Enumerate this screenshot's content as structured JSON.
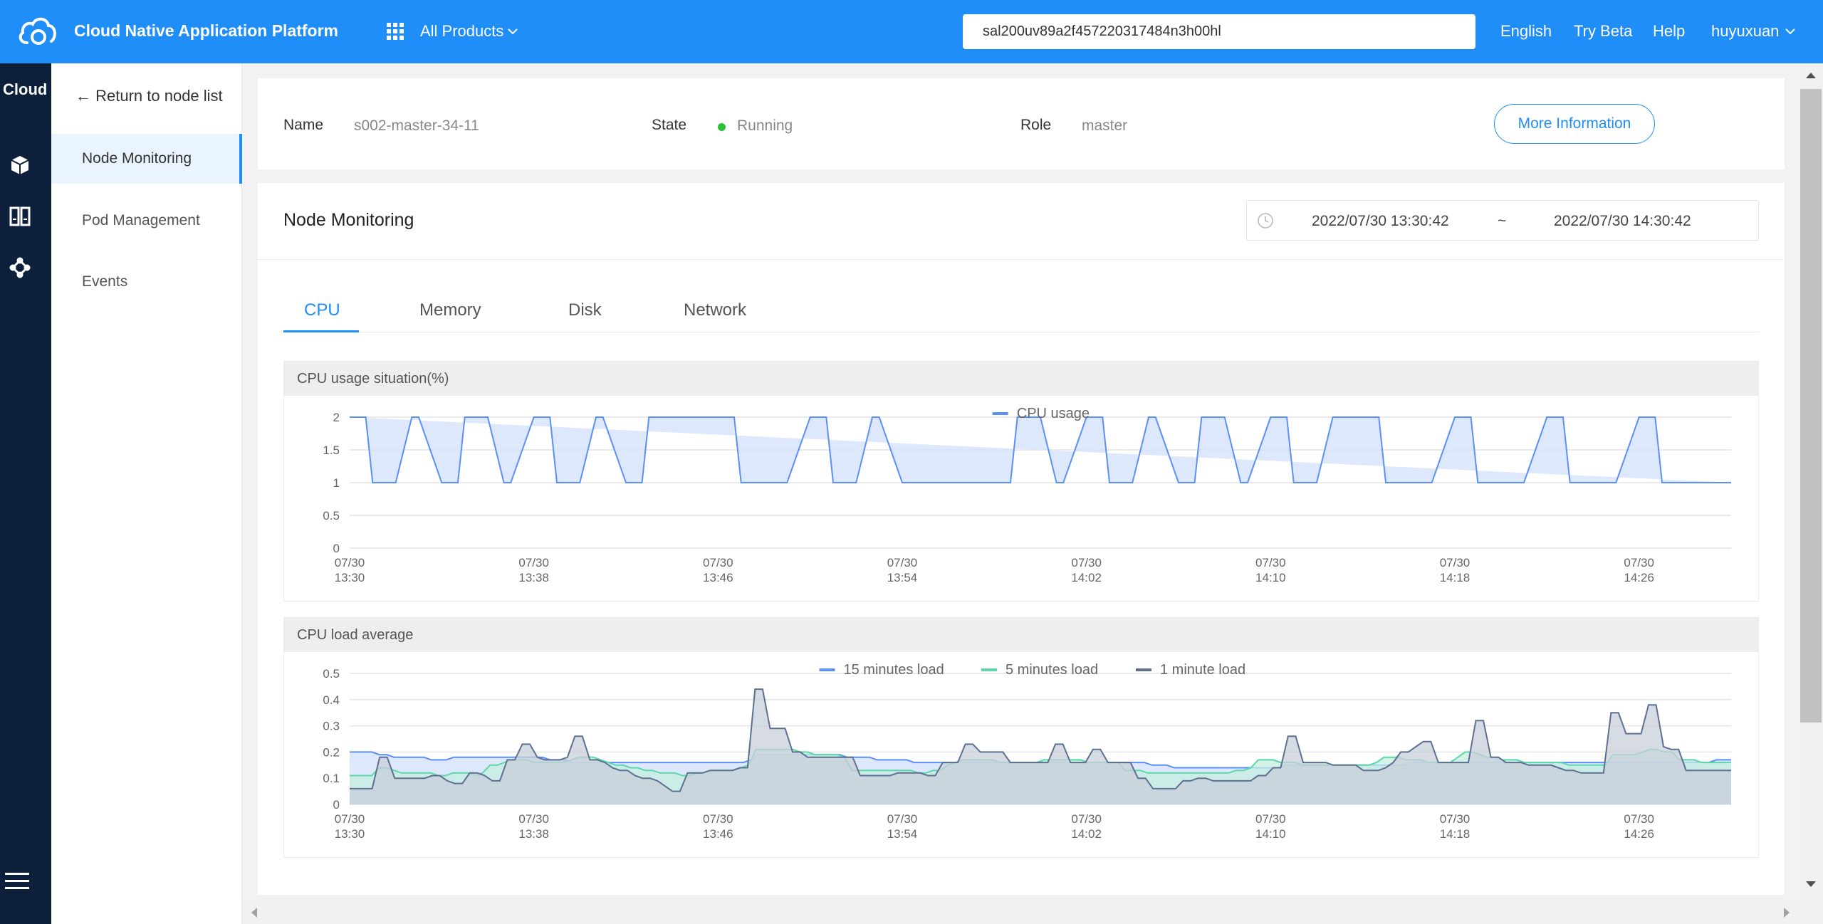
{
  "header": {
    "app_title": "Cloud Native Application Platform",
    "all_products": "All Products",
    "search_value": "sal200uv89a2f457220317484n3h00hl",
    "language": "English",
    "try_beta": "Try Beta",
    "help": "Help",
    "user": "huyuxuan",
    "bar_color": "#1f8ef8"
  },
  "rail": {
    "title": "Cloud",
    "icons": [
      "cube-icon",
      "columns-icon",
      "cluster-nodes-icon"
    ],
    "menu_icon": "hamburger-menu-icon"
  },
  "subnav": {
    "back_label": "← Return to node list",
    "items": [
      {
        "label": "Node Monitoring",
        "active": true
      },
      {
        "label": "Pod Management",
        "active": false
      },
      {
        "label": "Events",
        "active": false
      }
    ]
  },
  "node_info": {
    "name_label": "Name",
    "name_value": "s002-master-34-11",
    "state_label": "State",
    "state_value": "Running",
    "state_color": "#2bc234",
    "role_label": "Role",
    "role_value": "master",
    "more_button": "More Information"
  },
  "monitoring": {
    "title": "Node Monitoring",
    "time_start": "2022/07/30 13:30:42",
    "time_sep": "~",
    "time_end": "2022/07/30 14:30:42",
    "tabs": [
      {
        "label": "CPU",
        "active": true
      },
      {
        "label": "Memory",
        "active": false
      },
      {
        "label": "Disk",
        "active": false
      },
      {
        "label": "Network",
        "active": false
      }
    ],
    "cpu_usage_title": "CPU usage situation(%)",
    "cpu_load_title": "CPU load average"
  },
  "chart_data": [
    {
      "type": "area",
      "title": "CPU usage situation(%)",
      "x_ticks": [
        "07/30\n13:30",
        "07/30\n13:38",
        "07/30\n13:46",
        "07/30\n13:54",
        "07/30\n14:02",
        "07/30\n14:10",
        "07/30\n14:18",
        "07/30\n14:26"
      ],
      "ylim": [
        0,
        2
      ],
      "y_ticks": [
        0,
        0.5,
        1,
        1.5,
        2
      ],
      "grid": true,
      "legend_position": "top-center",
      "series": [
        {
          "name": "CPU usage",
          "color": "#5b8ff9",
          "fill": "#d3e0fb",
          "x_minutes": [
            0,
            0.7,
            1,
            2,
            2.7,
            3,
            4,
            4.7,
            5,
            6,
            6.7,
            7,
            8,
            8.7,
            9,
            10,
            10.7,
            11,
            12,
            12.7,
            13,
            14,
            14.7,
            15,
            16,
            16.7,
            17,
            18,
            18.7,
            19,
            20,
            20.7,
            21,
            22,
            22.7,
            23,
            24,
            24.7,
            25,
            26,
            26.7,
            27,
            28,
            28.7,
            29,
            30,
            30.7,
            31,
            32,
            32.7,
            33,
            34,
            34.7,
            35,
            36,
            36.7,
            37,
            38,
            38.7,
            39,
            40,
            40.7,
            41,
            42,
            42.7,
            43,
            44,
            44.7,
            45,
            46,
            46.7,
            47,
            48,
            48.7,
            49,
            50,
            50.7,
            51,
            52,
            52.7,
            53,
            54,
            54.7,
            55,
            56,
            56.7,
            57,
            58,
            58.7,
            59,
            60
          ],
          "values": [
            2,
            2,
            1,
            1,
            2,
            2,
            1,
            1,
            2,
            2,
            1,
            1,
            2,
            2,
            1,
            1,
            2,
            2,
            1,
            1,
            2,
            2,
            2,
            2,
            2,
            2,
            1,
            1,
            1,
            1,
            2,
            2,
            1,
            1,
            2,
            2,
            1,
            1,
            1,
            1,
            1,
            1,
            1,
            1,
            2,
            2,
            1,
            1,
            2,
            2,
            1,
            1,
            2,
            2,
            1,
            1,
            2,
            2,
            1,
            1,
            2,
            2,
            1,
            1,
            2,
            2,
            2,
            2,
            1,
            1,
            1,
            1,
            2,
            2,
            1,
            1,
            1,
            1,
            2,
            2,
            1,
            1,
            1,
            1,
            2,
            2,
            1,
            1,
            1,
            1,
            1,
            1
          ]
        }
      ]
    },
    {
      "type": "area",
      "title": "CPU load average",
      "x_ticks": [
        "07/30\n13:30",
        "07/30\n13:38",
        "07/30\n13:46",
        "07/30\n13:54",
        "07/30\n14:02",
        "07/30\n14:10",
        "07/30\n14:18",
        "07/30\n14:26"
      ],
      "ylim": [
        0,
        0.5
      ],
      "y_ticks": [
        0,
        0.1,
        0.2,
        0.3,
        0.4,
        0.5
      ],
      "grid": true,
      "legend_position": "top-center",
      "series": [
        {
          "name": "15 minutes load",
          "color": "#5b8ff9",
          "fill": "#d3e0fb",
          "values": [
            0.2,
            0.2,
            0.2,
            0.2,
            0.19,
            0.19,
            0.18,
            0.18,
            0.18,
            0.18,
            0.18,
            0.17,
            0.17,
            0.17,
            0.18,
            0.18,
            0.18,
            0.18,
            0.18,
            0.18,
            0.18,
            0.18,
            0.18,
            0.18,
            0.18,
            0.18,
            0.18,
            0.17,
            0.17,
            0.17,
            0.16,
            0.16,
            0.16,
            0.16,
            0.16,
            0.16,
            0.16,
            0.16,
            0.16,
            0.16,
            0.16,
            0.16,
            0.16,
            0.16,
            0.16,
            0.16,
            0.16,
            0.16,
            0.16,
            0.16,
            0.16,
            0.16,
            0.16,
            0.16,
            0.17,
            0.19,
            0.19,
            0.19,
            0.19,
            0.19,
            0.19,
            0.19,
            0.19,
            0.19,
            0.19,
            0.19,
            0.19,
            0.18,
            0.18,
            0.18,
            0.18,
            0.17,
            0.17,
            0.17,
            0.17,
            0.17,
            0.16,
            0.16,
            0.16,
            0.16,
            0.16,
            0.16,
            0.16,
            0.16,
            0.16,
            0.16,
            0.16,
            0.16,
            0.16,
            0.16,
            0.16,
            0.16,
            0.16,
            0.16,
            0.16,
            0.16,
            0.16,
            0.16,
            0.16,
            0.16,
            0.16,
            0.16,
            0.16,
            0.16,
            0.16,
            0.16,
            0.16,
            0.16,
            0.15,
            0.15,
            0.15,
            0.14,
            0.14,
            0.14,
            0.14,
            0.14,
            0.14,
            0.14,
            0.14,
            0.14,
            0.14,
            0.14,
            0.14,
            0.14,
            0.14,
            0.14,
            0.15,
            0.15,
            0.15,
            0.15,
            0.15,
            0.15,
            0.15,
            0.15,
            0.15,
            0.15,
            0.15,
            0.15,
            0.15,
            0.15,
            0.15,
            0.15,
            0.15,
            0.16,
            0.16,
            0.16,
            0.16,
            0.16,
            0.16,
            0.16,
            0.16,
            0.16,
            0.16,
            0.16,
            0.16,
            0.16,
            0.16,
            0.16,
            0.16,
            0.16,
            0.16,
            0.16,
            0.16,
            0.16,
            0.16,
            0.16,
            0.16,
            0.16,
            0.16,
            0.16,
            0.16,
            0.16,
            0.16,
            0.16,
            0.16,
            0.16,
            0.16,
            0.16,
            0.16,
            0.16,
            0.16,
            0.16,
            0.16,
            0.16,
            0.17,
            0.17,
            0.17
          ]
        },
        {
          "name": "5 minutes load",
          "color": "#5ad8a6",
          "fill": "#c6eee0",
          "values": [
            0.11,
            0.11,
            0.11,
            0.11,
            0.14,
            0.14,
            0.13,
            0.12,
            0.12,
            0.12,
            0.12,
            0.12,
            0.11,
            0.11,
            0.12,
            0.12,
            0.12,
            0.11,
            0.12,
            0.15,
            0.15,
            0.16,
            0.17,
            0.17,
            0.17,
            0.16,
            0.16,
            0.16,
            0.16,
            0.16,
            0.17,
            0.18,
            0.18,
            0.18,
            0.17,
            0.16,
            0.15,
            0.15,
            0.14,
            0.14,
            0.13,
            0.13,
            0.12,
            0.12,
            0.12,
            0.11,
            0.11,
            0.12,
            0.12,
            0.13,
            0.13,
            0.13,
            0.13,
            0.14,
            0.15,
            0.21,
            0.21,
            0.21,
            0.21,
            0.21,
            0.21,
            0.2,
            0.2,
            0.19,
            0.19,
            0.19,
            0.19,
            0.18,
            0.13,
            0.13,
            0.13,
            0.13,
            0.13,
            0.13,
            0.13,
            0.13,
            0.13,
            0.12,
            0.12,
            0.13,
            0.13,
            0.15,
            0.16,
            0.17,
            0.17,
            0.17,
            0.17,
            0.17,
            0.16,
            0.16,
            0.16,
            0.16,
            0.16,
            0.16,
            0.17,
            0.17,
            0.17,
            0.17,
            0.17,
            0.17,
            0.16,
            0.16,
            0.16,
            0.16,
            0.16,
            0.13,
            0.13,
            0.13,
            0.12,
            0.12,
            0.12,
            0.12,
            0.12,
            0.12,
            0.12,
            0.12,
            0.12,
            0.12,
            0.12,
            0.12,
            0.13,
            0.13,
            0.14,
            0.17,
            0.17,
            0.17,
            0.16,
            0.16,
            0.16,
            0.15,
            0.15,
            0.15,
            0.15,
            0.15,
            0.15,
            0.15,
            0.15,
            0.15,
            0.15,
            0.16,
            0.18,
            0.18,
            0.18,
            0.17,
            0.17,
            0.17,
            0.16,
            0.16,
            0.16,
            0.16,
            0.18,
            0.2,
            0.2,
            0.19,
            0.18,
            0.18,
            0.17,
            0.17,
            0.17,
            0.16,
            0.16,
            0.16,
            0.16,
            0.16,
            0.16,
            0.15,
            0.15,
            0.15,
            0.15,
            0.15,
            0.15,
            0.19,
            0.19,
            0.19,
            0.19,
            0.2,
            0.21,
            0.21,
            0.2,
            0.2,
            0.17,
            0.17,
            0.17,
            0.16,
            0.16,
            0.16,
            0.16,
            0.16
          ]
        },
        {
          "name": "1 minute load",
          "color": "#5d7092",
          "fill": "#c9cfda",
          "values": [
            0.06,
            0.06,
            0.06,
            0.06,
            0.18,
            0.18,
            0.1,
            0.1,
            0.1,
            0.1,
            0.1,
            0.11,
            0.11,
            0.09,
            0.08,
            0.08,
            0.12,
            0.12,
            0.11,
            0.09,
            0.09,
            0.17,
            0.17,
            0.23,
            0.23,
            0.18,
            0.17,
            0.17,
            0.17,
            0.18,
            0.26,
            0.26,
            0.17,
            0.17,
            0.16,
            0.14,
            0.13,
            0.13,
            0.11,
            0.1,
            0.1,
            0.09,
            0.07,
            0.05,
            0.05,
            0.12,
            0.12,
            0.12,
            0.13,
            0.13,
            0.13,
            0.13,
            0.14,
            0.14,
            0.44,
            0.44,
            0.29,
            0.29,
            0.29,
            0.2,
            0.2,
            0.18,
            0.18,
            0.18,
            0.18,
            0.18,
            0.18,
            0.18,
            0.11,
            0.11,
            0.11,
            0.11,
            0.11,
            0.12,
            0.12,
            0.12,
            0.12,
            0.11,
            0.11,
            0.16,
            0.16,
            0.16,
            0.23,
            0.23,
            0.2,
            0.2,
            0.2,
            0.2,
            0.16,
            0.16,
            0.16,
            0.16,
            0.16,
            0.16,
            0.23,
            0.23,
            0.16,
            0.16,
            0.16,
            0.21,
            0.21,
            0.16,
            0.16,
            0.16,
            0.16,
            0.1,
            0.1,
            0.06,
            0.06,
            0.06,
            0.06,
            0.09,
            0.09,
            0.1,
            0.1,
            0.09,
            0.09,
            0.09,
            0.09,
            0.09,
            0.09,
            0.11,
            0.11,
            0.14,
            0.14,
            0.26,
            0.26,
            0.16,
            0.16,
            0.16,
            0.16,
            0.15,
            0.15,
            0.15,
            0.15,
            0.13,
            0.13,
            0.13,
            0.14,
            0.16,
            0.2,
            0.2,
            0.22,
            0.24,
            0.24,
            0.16,
            0.16,
            0.16,
            0.16,
            0.16,
            0.32,
            0.32,
            0.18,
            0.18,
            0.16,
            0.16,
            0.16,
            0.15,
            0.15,
            0.15,
            0.15,
            0.14,
            0.13,
            0.13,
            0.12,
            0.12,
            0.12,
            0.12,
            0.35,
            0.35,
            0.27,
            0.27,
            0.27,
            0.38,
            0.38,
            0.22,
            0.21,
            0.21,
            0.13,
            0.13,
            0.13,
            0.13,
            0.13,
            0.13,
            0.13
          ]
        }
      ]
    }
  ]
}
